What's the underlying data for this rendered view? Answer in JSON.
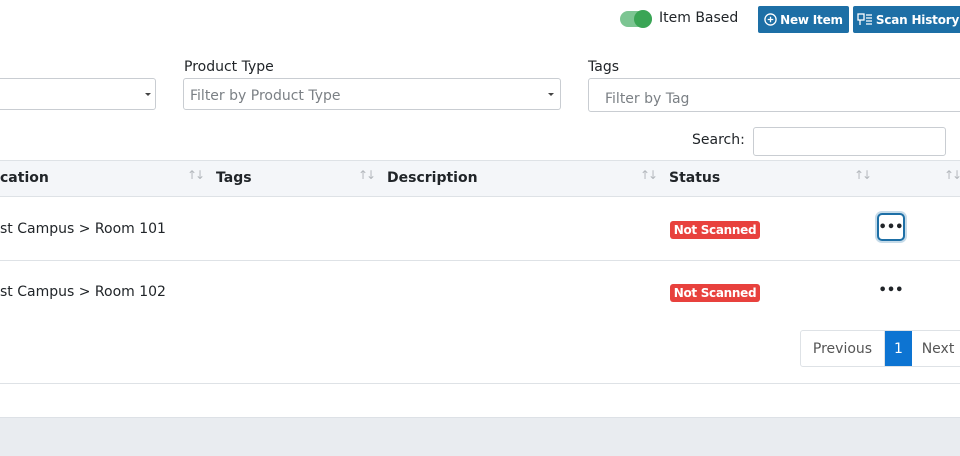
{
  "toolbar": {
    "item_based_label": "Item Based",
    "item_based_enabled": true,
    "new_item_label": "New Item",
    "scan_history_label": "Scan History"
  },
  "filters": {
    "product_type_label": "Product Type",
    "product_type_placeholder": "Filter by Product Type",
    "tags_label": "Tags",
    "tags_placeholder": "Filter by Tag"
  },
  "search": {
    "label": "Search:",
    "value": ""
  },
  "table": {
    "columns": [
      "cation",
      "Tags",
      "Description",
      "Status"
    ],
    "rows": [
      {
        "location": "st Campus > Room 101",
        "tags": "",
        "description": "",
        "status": "Not Scanned"
      },
      {
        "location": "st Campus > Room 102",
        "tags": "",
        "description": "",
        "status": "Not Scanned"
      }
    ]
  },
  "pagination": {
    "previous_label": "Previous",
    "current_page": "1",
    "next_label": "Next"
  },
  "colors": {
    "primary": "#1d6fa6",
    "toggle_on": "#3aa555",
    "status_not_scanned": "#e8413d",
    "page_active": "#0d74d2"
  }
}
